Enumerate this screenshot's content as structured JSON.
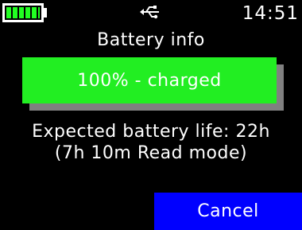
{
  "status_bar": {
    "battery_icon": "battery-icon",
    "battery_level": 1.0,
    "usb_icon": "usb-connected-icon",
    "time": "14:51"
  },
  "screen": {
    "title": "Battery info",
    "charge_status": "100% - charged",
    "expected_life": "Expected battery life: 22h",
    "read_mode_life": "(7h 10m Read mode)"
  },
  "actions": {
    "cancel_label": "Cancel"
  },
  "colors": {
    "background": "#000000",
    "text": "#ffffff",
    "charge_box": "#22ee22",
    "charge_box_shadow": "#808080",
    "battery_fill": "#22ff22",
    "cancel_button": "#0000ff"
  }
}
